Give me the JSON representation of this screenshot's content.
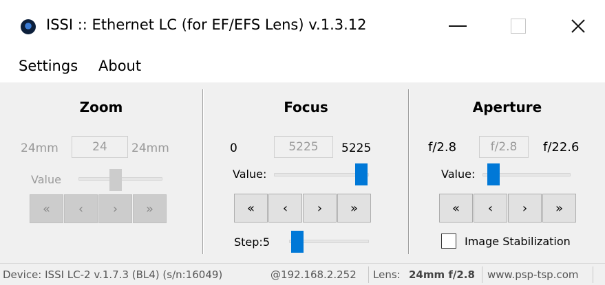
{
  "window": {
    "title": "ISSI :: Ethernet LC (for EF/EFS Lens) v.1.3.12",
    "close_glyph": "✕"
  },
  "menu": {
    "items": [
      "Settings",
      "About"
    ]
  },
  "zoom": {
    "title": "Zoom",
    "min_label": "24mm",
    "value": "24",
    "max_label": "24mm",
    "value_label": "Value",
    "slider_level": 0.5,
    "enabled": false,
    "buttons": [
      "«",
      "‹",
      "›",
      "»"
    ]
  },
  "focus": {
    "title": "Focus",
    "min_label": "0",
    "value": "5225",
    "max_label": "5225",
    "value_label": "Value:",
    "slider_level": 1.0,
    "buttons": [
      "«",
      "‹",
      "›",
      "»"
    ],
    "step_label": "Step:5",
    "step_level": 0.1
  },
  "aperture": {
    "title": "Aperture",
    "min_label": "f/2.8",
    "value": "f/2.8",
    "max_label": "f/22.6",
    "value_label": "Value:",
    "slider_level": 0.0,
    "buttons": [
      "«",
      "‹",
      "›",
      "»"
    ],
    "stabilization_label": "Image Stabilization",
    "stabilization_checked": false
  },
  "status": {
    "device": "Device: ISSI LC-2 v.1.7.3 (BL4) (s/n:16049)",
    "ip": "@192.168.2.252",
    "lens_label": "Lens:",
    "lens_value": "24mm f/2.8",
    "website": "www.psp-tsp.com"
  },
  "colors": {
    "accent": "#0078d7",
    "disabled_text": "#9a9a9a",
    "panel_bg": "#f0f0f0"
  }
}
